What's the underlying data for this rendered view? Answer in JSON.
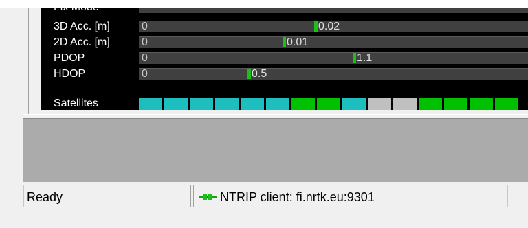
{
  "panel": {
    "rows": [
      {
        "label": "Fix Mode"
      },
      {
        "label": "3D Acc. [m]",
        "min": "0",
        "value": "0.02",
        "marker": 0.45
      },
      {
        "label": "2D Acc. [m]",
        "min": "0",
        "value": "0.01",
        "marker": 0.37
      },
      {
        "label": "PDOP",
        "min": "0",
        "value": "1.1",
        "marker": 0.55
      },
      {
        "label": "HDOP",
        "min": "0",
        "value": "0.5",
        "marker": 0.28
      },
      {
        "label": "Satellites"
      }
    ],
    "satellites": [
      "cyan",
      "cyan",
      "cyan",
      "cyan",
      "cyan",
      "cyan",
      "green",
      "green",
      "cyan",
      "gray",
      "gray",
      "green",
      "green",
      "green",
      "green"
    ],
    "colors": {
      "cyan": "#1ebebe",
      "green": "#00c000",
      "gray": "#c0c0c0",
      "marker": "#18c018"
    }
  },
  "status": {
    "left": "Ready",
    "connection": "NTRIP client: fi.nrtk.eu:9301"
  },
  "icons": {
    "connection": "connector-icon"
  }
}
